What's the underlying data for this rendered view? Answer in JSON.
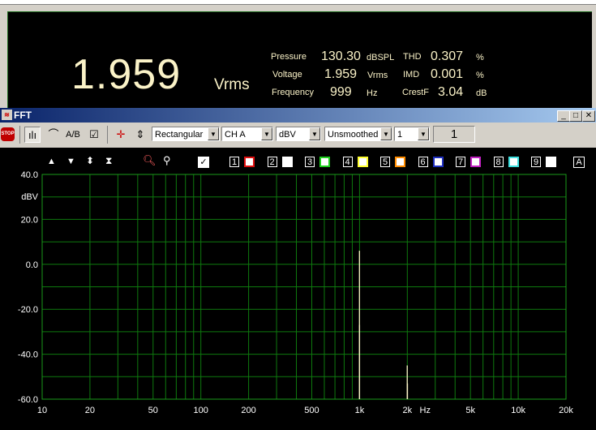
{
  "meter": {
    "value": "1.959",
    "unit": "Vrms",
    "rows": [
      {
        "label": "Pressure",
        "value": "130.30",
        "unit": "dBSPL",
        "label2": "THD",
        "value2": "0.307",
        "unit2": "%"
      },
      {
        "label": "Voltage",
        "value": "1.959",
        "unit": "Vrms",
        "label2": "IMD",
        "value2": "0.001",
        "unit2": "%"
      },
      {
        "label": "Frequency",
        "value": "999",
        "unit": "Hz",
        "label2": "CrestF",
        "value2": "3.04",
        "unit2": "dB"
      }
    ]
  },
  "window": {
    "title": "FFT"
  },
  "toolbar": {
    "window_combo": "Rectangular",
    "channel_combo": "CH A",
    "unit_combo": "dBV",
    "smoothing_combo": "Unsmoothed",
    "average_combo": "1",
    "counter": "1"
  },
  "channels": [
    {
      "num": "1",
      "color": "#e01010"
    },
    {
      "num": "2",
      "color": "#ffffff"
    },
    {
      "num": "3",
      "color": "#20d020"
    },
    {
      "num": "4",
      "color": "#ffff30"
    },
    {
      "num": "5",
      "color": "#ff8c00"
    },
    {
      "num": "6",
      "color": "#2030c0"
    },
    {
      "num": "7",
      "color": "#c020c0"
    },
    {
      "num": "8",
      "color": "#40e0e0"
    },
    {
      "num": "9",
      "color": "#ffffff"
    }
  ],
  "all_label": "A",
  "chart_data": {
    "type": "line",
    "xscale": "log",
    "xlim": [
      10,
      20000
    ],
    "ylim": [
      -60,
      40
    ],
    "ylabel": "dBV",
    "xlabel": "Hz",
    "grid": true,
    "y_ticks": [
      "40.0",
      "20.0",
      "0.0",
      "-20.0",
      "-40.0",
      "-60.0"
    ],
    "x_ticks": [
      {
        "value": 10,
        "label": "10"
      },
      {
        "value": 20,
        "label": "20"
      },
      {
        "value": 50,
        "label": "50"
      },
      {
        "value": 100,
        "label": "100"
      },
      {
        "value": 200,
        "label": "200"
      },
      {
        "value": 500,
        "label": "500"
      },
      {
        "value": 1000,
        "label": "1k"
      },
      {
        "value": 2000,
        "label": "2k"
      },
      {
        "value": 5000,
        "label": "5k"
      },
      {
        "value": 10000,
        "label": "10k"
      },
      {
        "value": 20000,
        "label": "20k"
      }
    ],
    "peaks": [
      {
        "freq": 999,
        "level": 6.0
      },
      {
        "freq": 1000,
        "level": -27.0
      },
      {
        "freq": 1998,
        "level": -45.0
      },
      {
        "freq": 2004,
        "level": -53.0
      }
    ],
    "trace_color": "#fbf3c8"
  }
}
